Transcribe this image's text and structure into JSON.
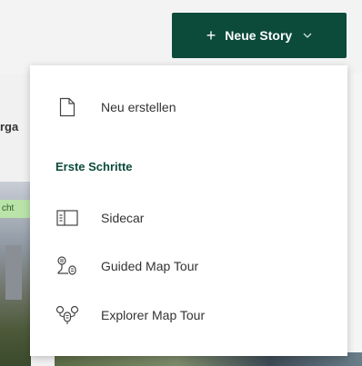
{
  "header": {
    "new_story_button": {
      "label": "Neue Story",
      "plus": "+"
    }
  },
  "background": {
    "left_text": "rga",
    "left_tag": "cht"
  },
  "menu": {
    "create_new": {
      "label": "Neu erstellen",
      "icon": "document-icon"
    },
    "section_title": "Erste Schritte",
    "items": [
      {
        "label": "Sidecar",
        "icon": "sidecar-icon"
      },
      {
        "label": "Guided Map Tour",
        "icon": "guided-map-tour-icon"
      },
      {
        "label": "Explorer Map Tour",
        "icon": "explorer-map-tour-icon"
      }
    ]
  },
  "colors": {
    "primary": "#0c4a3a",
    "accent_text": "#0c4a3a",
    "menu_background": "#ffffff"
  }
}
